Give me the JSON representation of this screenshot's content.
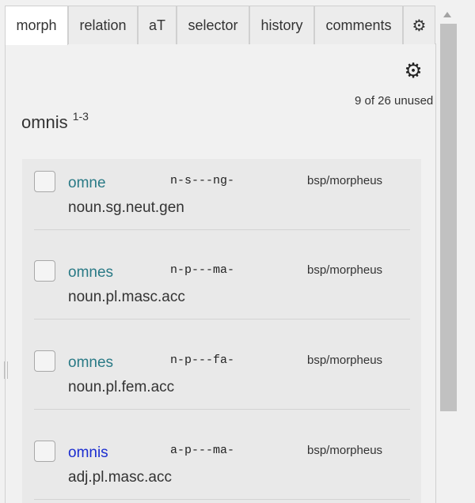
{
  "tabs": [
    {
      "label": "morph"
    },
    {
      "label": "relation"
    },
    {
      "label": "aT"
    },
    {
      "label": "selector"
    },
    {
      "label": "history"
    },
    {
      "label": "comments"
    }
  ],
  "tab_settings_icon": "gear-icon",
  "header": {
    "settings_icon": "gear-icon",
    "unused_count": "9 of 26 unused"
  },
  "lemma": {
    "word": "omnis",
    "superscript": "1-3"
  },
  "entries": [
    {
      "form": "omne",
      "tag": "n-s---ng-",
      "source": "bsp/morpheus",
      "parse": "noun.sg.neut.gen",
      "color": "#2a7a86"
    },
    {
      "form": "omnes",
      "tag": "n-p---ma-",
      "source": "bsp/morpheus",
      "parse": "noun.pl.masc.acc",
      "color": "#2a7a86"
    },
    {
      "form": "omnes",
      "tag": "n-p---fa-",
      "source": "bsp/morpheus",
      "parse": "noun.pl.fem.acc",
      "color": "#2a7a86"
    },
    {
      "form": "omnis",
      "tag": "a-p---ma-",
      "source": "bsp/morpheus",
      "parse": "adj.pl.masc.acc",
      "color": "#1c2ed0"
    }
  ]
}
